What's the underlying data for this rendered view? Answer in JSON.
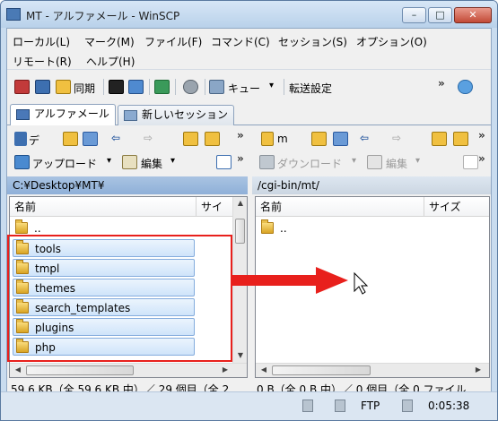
{
  "window": {
    "title": "MT - アルファメール - WinSCP",
    "minimize": "–",
    "maximize": "□",
    "close": "✕"
  },
  "menu": {
    "row1": [
      "ローカル(L)",
      "マーク(M)",
      "ファイル(F)",
      "コマンド(C)",
      "セッション(S)",
      "オプション(O)"
    ],
    "row2": [
      "リモート(R)",
      "ヘルプ(H)"
    ]
  },
  "toolbar1": {
    "sync_label": "同期",
    "queue_label": "キュー",
    "queue_arrow": "▾",
    "transfer_label": "転送設定",
    "more": "»"
  },
  "tabs": {
    "active": "アルファメール",
    "new_session": "新しいセッション"
  },
  "left": {
    "drive_label": "デ",
    "upload_label": "アップロード",
    "edit_label": "編集",
    "path": "C:¥Desktop¥MT¥",
    "col_name": "名前",
    "col_size": "サイ",
    "parent": "..",
    "folders": [
      "tools",
      "tmpl",
      "themes",
      "search_templates",
      "plugins",
      "php"
    ],
    "status": "59.6 KB（全 59.6 KB 中）／ 29 個目（全 2..."
  },
  "right": {
    "drive_label": "m",
    "download_label": "ダウンロード",
    "edit_label": "編集",
    "path": "/cgi-bin/mt/",
    "col_name": "名前",
    "col_size": "サイズ",
    "parent": "..",
    "status": "0 B（全 0 B 中）／ 0 個目（全 0 ファイル..."
  },
  "statusbar": {
    "protocol": "FTP",
    "time": "0:05:38"
  },
  "colors": {
    "accent": "#3d6fb0",
    "highlight_box": "#e8201c",
    "arrow": "#e8201c"
  }
}
